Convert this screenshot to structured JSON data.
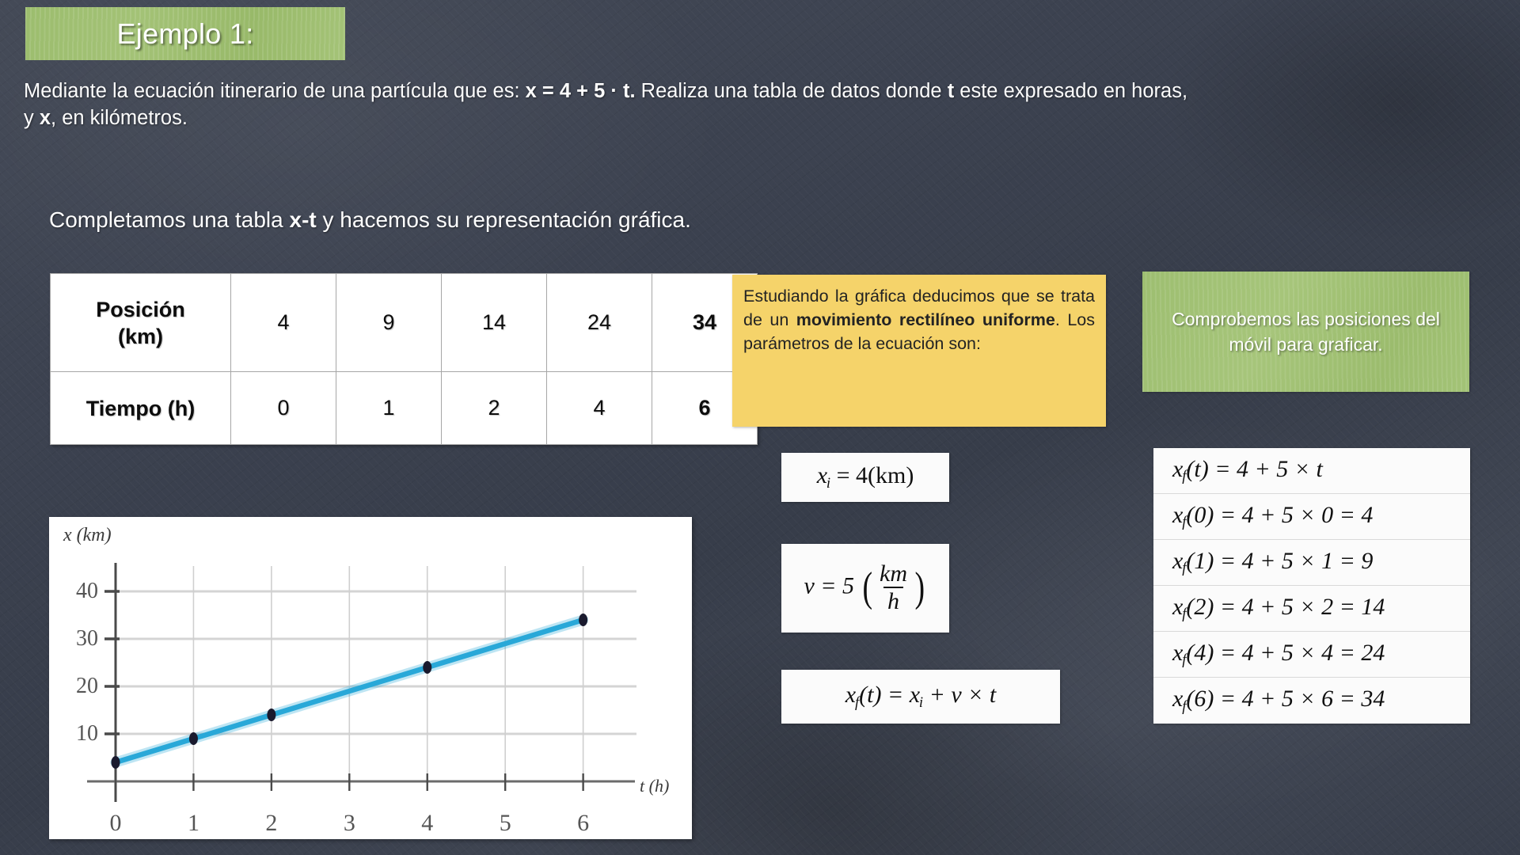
{
  "title": {
    "label": "Ejemplo 1:"
  },
  "intro": {
    "part1": "Mediante la ecuación itinerario de una partícula que es: ",
    "equation": "x = 4 + 5 · t.",
    "part2": " Realiza  una tabla de datos donde ",
    "var_t": "t",
    "part3": " este expresado en horas, y ",
    "var_x": "x",
    "part4": ", en kilómetros."
  },
  "subline": {
    "part1": "Completamos una tabla ",
    "bold": "x-t",
    "part2": " y hacemos su representación gráfica."
  },
  "table": {
    "row_labels": [
      "Posición (km)",
      "Tiempo (h)"
    ],
    "position_label_line1": "Posición",
    "position_label_line2": "(km)",
    "time_label": "Tiempo (h)",
    "positions": [
      "4",
      "9",
      "14",
      "24",
      "34"
    ],
    "times": [
      "0",
      "1",
      "2",
      "4",
      "6"
    ]
  },
  "note_yellow": {
    "text_a": "Estudiando la gráfica deducimos que se trata de un ",
    "bold_a": "movimiento rectilíneo uniforme",
    "text_b": ".",
    "text_c": "Los parámetros de la ecuación son:"
  },
  "note_green": {
    "text": "Comprobemos las posiciones  del móvil para graficar."
  },
  "formulas": {
    "xi": {
      "lhs": "x",
      "sub": "i",
      "eq": " = 4(km)"
    },
    "v": {
      "lhs": "v = 5",
      "num": "km",
      "den": "h"
    },
    "xf": {
      "p1": "x",
      "s1": "f",
      "p2": "(t) = ",
      "p3": "x",
      "s2": "i",
      "p4": " + v × t"
    }
  },
  "equations": [
    {
      "lhs_var": "x",
      "lhs_sub": "f",
      "arg": "(t)",
      "rhs": " =  4  + 5 × t"
    },
    {
      "lhs_var": "x",
      "lhs_sub": "f",
      "arg": "(0)",
      "rhs": " =  4  + 5 × 0 = 4"
    },
    {
      "lhs_var": "x",
      "lhs_sub": "f",
      "arg": "(1)",
      "rhs": " =  4  + 5 × 1 = 9"
    },
    {
      "lhs_var": "x",
      "lhs_sub": "f",
      "arg": "(2)",
      "rhs": " =  4  + 5 × 2 = 14"
    },
    {
      "lhs_var": "x",
      "lhs_sub": "f",
      "arg": "(4)",
      "rhs": " =  4  + 5 × 4 = 24"
    },
    {
      "lhs_var": "x",
      "lhs_sub": "f",
      "arg": "(6)",
      "rhs": " =  4  + 5 × 6 = 34"
    }
  ],
  "chart_data": {
    "type": "line",
    "title": "",
    "xlabel": "t (h)",
    "ylabel": "x (km)",
    "x": [
      0,
      1,
      2,
      4,
      6
    ],
    "values": [
      4,
      9,
      14,
      24,
      34
    ],
    "series": [
      {
        "name": "x(t) = 4 + 5t",
        "values": [
          4,
          9,
          14,
          24,
          34
        ]
      }
    ],
    "xticks": [
      0,
      1,
      2,
      3,
      4,
      5,
      6
    ],
    "yticks": [
      10,
      20,
      30,
      40
    ],
    "xlim": [
      0,
      6.4
    ],
    "ylim": [
      0,
      44
    ],
    "grid": true,
    "line_color": "#29a8d8",
    "marker_color": "#1a1a2e",
    "legend": "none"
  },
  "colors": {
    "board": "#3b414e",
    "green": "#9dbe70",
    "yellow": "#f5d36a",
    "line": "#29a8d8"
  }
}
